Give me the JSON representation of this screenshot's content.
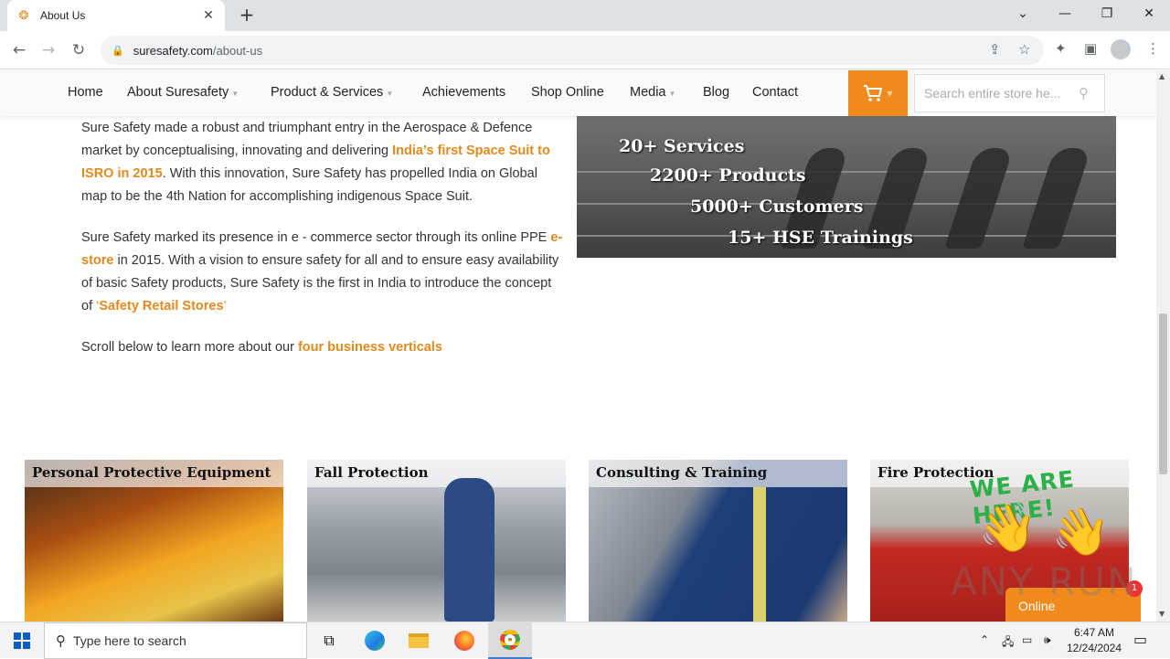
{
  "browser": {
    "tab_title": "About Us",
    "url_domain": "suresafety.com",
    "url_path": "/about-us"
  },
  "site_nav": {
    "items": [
      "Home",
      "About Suresafety",
      "Product & Services",
      "Achievements",
      "Shop Online",
      "Media",
      "Blog",
      "Contact"
    ],
    "search_placeholder": "Search entire store he..."
  },
  "content": {
    "p1_a": "Sure Safety made a robust and triumphant entry in the Aerospace & Defence market by conceptualising, innovating and delivering ",
    "p1_hl": "India’s first Space Suit to ISRO in 2015",
    "p1_b": ". With this innovation, Sure Safety has propelled India on Global map to be the 4th Nation for accomplishing indigenous Space Suit.",
    "p2_a": "Sure Safety marked its presence in e - commerce sector through its online PPE ",
    "p2_hl": "e-store",
    "p2_b": " in 2015. With a vision to ensure safety for all and to ensure easy availability of basic Safety products, Sure Safety is the first in India to introduce the concept of ",
    "p2_q1": "‘",
    "p2_hl2": "Safety Retail Stores",
    "p2_q2": "’",
    "p3_a": "Scroll below to learn more about our ",
    "p3_hl": "four business verticals"
  },
  "banner_stats": [
    "20+ Services",
    "2200+ Products",
    "5000+ Customers",
    "15+ HSE Trainings"
  ],
  "verticals": [
    "Personal Protective Equipment",
    "Fall Protection",
    "Consulting & Training",
    "Fire Protection"
  ],
  "chat_widget": {
    "headline": "WE ARE HERE!",
    "status": "Online",
    "badge": "1"
  },
  "watermark": "ANY RUN",
  "taskbar": {
    "search_placeholder": "Type here to search",
    "time": "6:47 AM",
    "date": "12/24/2024"
  },
  "colors": {
    "accent": "#f08a1c",
    "link": "#e08a1e"
  }
}
